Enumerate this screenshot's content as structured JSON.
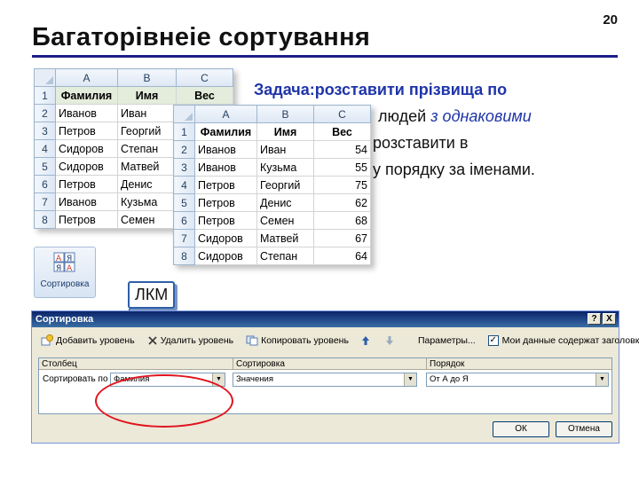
{
  "slide": {
    "title": "Багаторівнеіе сортування",
    "page_number": "20",
    "task_label": "Задача:",
    "task_line1": "розставити прізвища по",
    "task_line2_end": "людей ",
    "task_line2_em": "з однаковими",
    "task_line3_end": " розставити в",
    "task_line4_end": "у порядку за іменами."
  },
  "sheet_back": {
    "col_heads": [
      "A",
      "B",
      "C"
    ],
    "row_heads": [
      "1",
      "2",
      "3",
      "4",
      "5",
      "6",
      "7",
      "8"
    ],
    "header": [
      "Фамилия",
      "Имя",
      "Вес"
    ],
    "rows": [
      [
        "Иванов",
        "Иван",
        ""
      ],
      [
        "Петров",
        "Георгий",
        ""
      ],
      [
        "Сидоров",
        "Степан",
        ""
      ],
      [
        "Сидоров",
        "Матвей",
        ""
      ],
      [
        "Петров",
        "Денис",
        ""
      ],
      [
        "Иванов",
        "Кузьма",
        ""
      ],
      [
        "Петров",
        "Семен",
        ""
      ]
    ]
  },
  "sheet_front": {
    "col_heads": [
      "A",
      "B",
      "C"
    ],
    "row_heads": [
      "1",
      "2",
      "3",
      "4",
      "5",
      "6",
      "7",
      "8"
    ],
    "header": [
      "Фамилия",
      "Имя",
      "Вес"
    ],
    "rows": [
      [
        "Иванов",
        "Иван",
        "54"
      ],
      [
        "Иванов",
        "Кузьма",
        "55"
      ],
      [
        "Петров",
        "Георгий",
        "75"
      ],
      [
        "Петров",
        "Денис",
        "62"
      ],
      [
        "Петров",
        "Семен",
        "68"
      ],
      [
        "Сидоров",
        "Матвей",
        "67"
      ],
      [
        "Сидоров",
        "Степан",
        "64"
      ]
    ]
  },
  "sort_button": {
    "label": "Сортировка",
    "icon": "sort-az-icon"
  },
  "callout": {
    "text": "ЛКМ"
  },
  "dialog": {
    "title": "Сортировка",
    "help_btn": "?",
    "close_btn": "X",
    "toolbar": {
      "add_level": "Добавить уровень",
      "delete_level": "Удалить уровень",
      "copy_level": "Копировать уровень",
      "params": "Параметры...",
      "has_headers": "Мои данные содержат заголовки"
    },
    "columns": {
      "column": "Столбец",
      "sort_on": "Сортировка",
      "order": "Порядок"
    },
    "row": {
      "label": "Сортировать по",
      "column_value": "Фамилия",
      "sort_on_value": "Значения",
      "order_value": "От А до Я"
    },
    "ok": "ОК",
    "cancel": "Отмена"
  },
  "colors": {
    "accent": "#1f35a8",
    "title_rule": "#1e1e8a",
    "highlight_oval": "#e0141e"
  }
}
